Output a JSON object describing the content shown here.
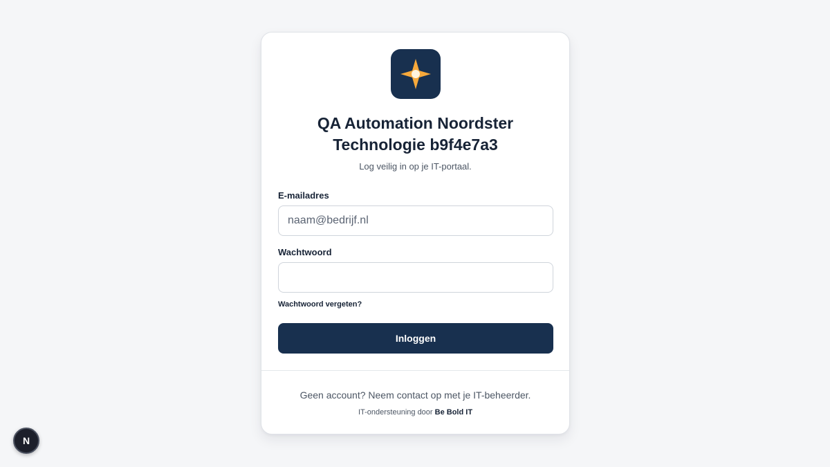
{
  "brand": {
    "title": "QA Automation Noordster Technologie b9f4e7a3",
    "subtitle": "Log veilig in op je IT-portaal.",
    "logo_icon": "compass-star-icon",
    "logo_bg_color": "#18304f",
    "logo_star_color": "#f7a93b"
  },
  "form": {
    "email_label": "E-mailadres",
    "email_placeholder": "naam@bedrijf.nl",
    "email_value": "",
    "password_label": "Wachtwoord",
    "password_value": "",
    "forgot_link": "Wachtwoord vergeten?",
    "submit_label": "Inloggen",
    "primary_color": "#18304f"
  },
  "footer": {
    "no_account_text": "Geen account? Neem contact op met je IT-beheerder.",
    "support_prefix": "IT-ondersteuning door",
    "support_company": "Be Bold IT"
  },
  "dev_badge": {
    "letter": "N",
    "icon": "nextjs-dev-indicator-icon"
  }
}
